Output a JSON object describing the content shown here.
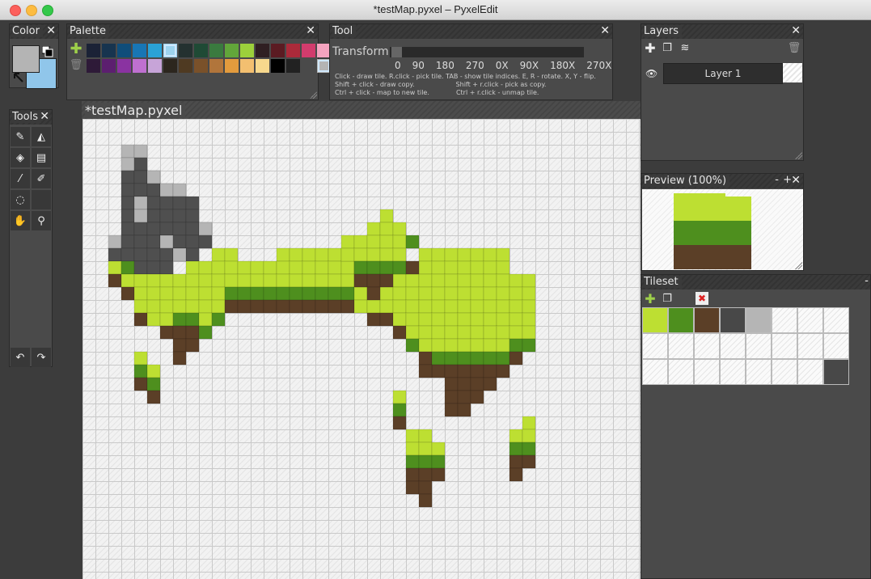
{
  "window": {
    "title": "*testMap.pyxel – PyxelEdit"
  },
  "panels": {
    "color": {
      "title": "Color",
      "close": "✕",
      "primary": "#b4b4b4",
      "secondary": "#90c6ea"
    },
    "palette": {
      "title": "Palette",
      "close": "✕",
      "colors": [
        "#1b2236",
        "#17344f",
        "#0f4d7a",
        "#1876b5",
        "#2aa2d6",
        "#9dd3ee",
        "#243130",
        "#1f4a35",
        "#3a7a3f",
        "#62a63a",
        "#9cd03b",
        "#2f1f22",
        "#5b1b22",
        "#ab2a3a",
        "#d23c6d",
        "#f5a3bf",
        "#2e1a38",
        "#5c1f6f",
        "#8a33a1",
        "#bf70d0",
        "#c7a4d8",
        "#2c261e",
        "#4f3a22",
        "#7a512a",
        "#b1753b",
        "#e39b3d",
        "#f3bf70",
        "#f7d88d",
        "#000000",
        "#222222",
        "#4a4a4a",
        "#b4b4b4"
      ]
    },
    "tool": {
      "title": "Tool",
      "close": "✕",
      "mode": "Transform",
      "angles": [
        "0",
        "90",
        "180",
        "270",
        "0X",
        "90X",
        "180X",
        "270X"
      ],
      "help_lines": "Click - draw tile. R.click - pick tile. TAB - show tile indices. E, R - rotate. X, Y - flip.\nShift + click - draw copy.                    Shift + r.click - pick as copy.\nCtrl + click - map to new tile.             Ctrl + r.click - unmap tile."
    },
    "tools": {
      "title": "Tools",
      "close": "✕"
    },
    "layers": {
      "title": "Layers",
      "close": "✕",
      "layer_name": "Layer 1"
    },
    "preview": {
      "title": "Preview (100%)",
      "minus": "-",
      "plus": "+",
      "close": "✕"
    },
    "tileset": {
      "title": "Tileset",
      "minus": "-"
    },
    "document": {
      "title": "*testMap.pyxel"
    }
  },
  "icons": {
    "tools": [
      "pencil-icon",
      "eraser-icon",
      "fill-icon",
      "stamp-icon",
      "eyedropper-icon",
      "brush-icon",
      "select-icon",
      "blank",
      "hand-icon",
      "zoom-icon"
    ],
    "undo": "↶",
    "redo": "↷"
  },
  "colors": {
    "grass_light": "#bddf32",
    "grass_dark": "#4e8f1e",
    "dirt": "#5b3f27",
    "rock_dark": "#4f4f4f",
    "rock_light": "#b5b5b5"
  }
}
